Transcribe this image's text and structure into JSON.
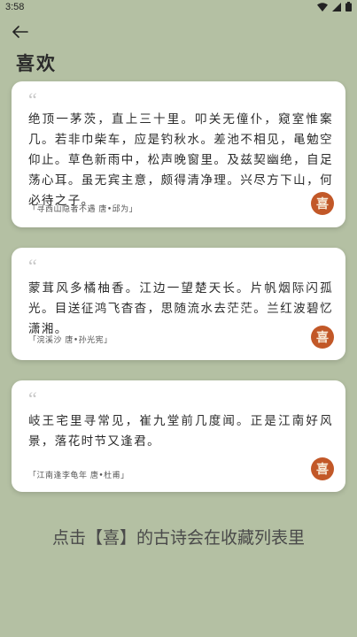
{
  "status_bar": {
    "time": "3:58"
  },
  "header": {
    "back_icon": "arrow-left-icon",
    "title": "喜欢"
  },
  "poems": [
    {
      "quote_mark": "“",
      "text": "绝顶一茅茨，直上三十里。叩关无僮仆，窥室惟案几。若非巾柴车，应是钓秋水。差池不相见，黾勉空仰止。草色新雨中，松声晚窗里。及兹契幽绝，自足荡心耳。虽无宾主意，颇得清净理。兴尽方下山，何必待之子。",
      "source": "「寻西山隐者不遇 唐•邱为」",
      "like_label": "喜"
    },
    {
      "quote_mark": "“",
      "text": "蒙茸风多橘柚香。江边一望楚天长。片帆烟际闪孤光。目送征鸿飞杳杳，思随流水去茫茫。兰红波碧忆潇湘。",
      "source": "「浣溪沙 唐•孙光宪」",
      "like_label": "喜"
    },
    {
      "quote_mark": "“",
      "text": "岐王宅里寻常见，崔九堂前几度闻。正是江南好风景，落花时节又逢君。",
      "source": "「江南逢李龟年 唐•杜甫」",
      "like_label": "喜"
    }
  ],
  "hint": "点击【喜】的古诗会在收藏列表里",
  "colors": {
    "background": "#b4c0a3",
    "card": "#ffffff",
    "accent": "#c25828"
  }
}
